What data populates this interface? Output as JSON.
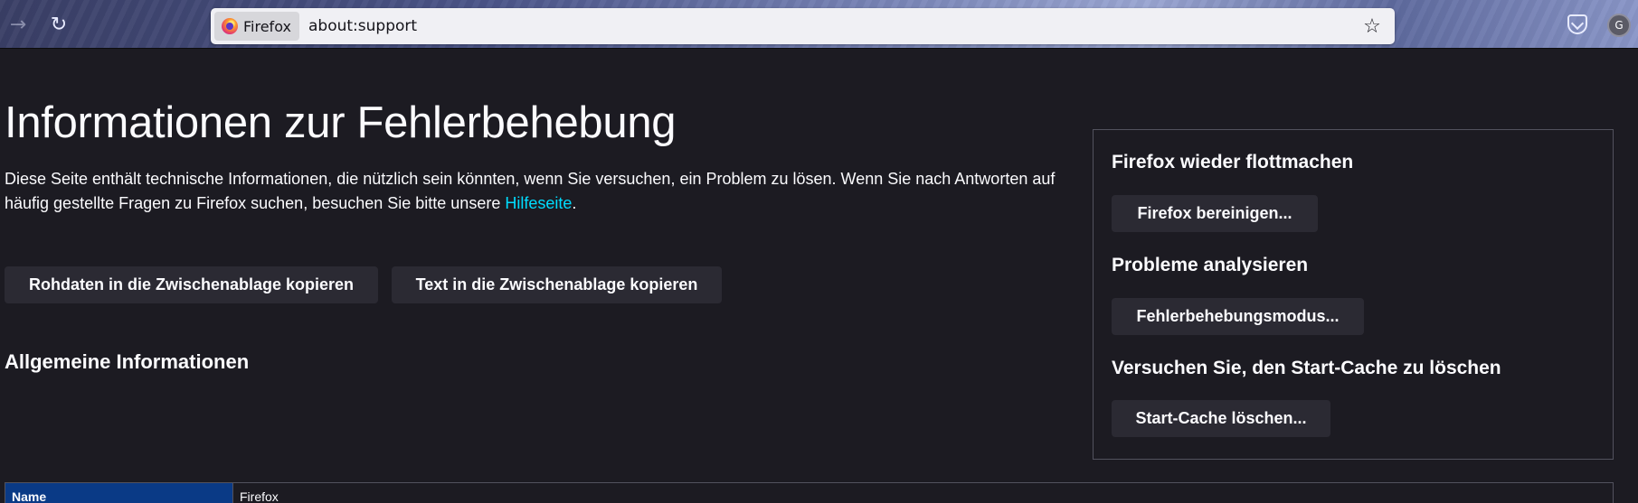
{
  "browser": {
    "identity_label": "Firefox",
    "url": "about:support",
    "icons": {
      "back": "back-arrow-icon",
      "reload": "reload-icon",
      "bookmark": "star-icon",
      "pocket": "pocket-icon",
      "account": "account-icon"
    },
    "account_initial": "G"
  },
  "page": {
    "title": "Informationen zur Fehlerbehebung",
    "intro_text": "Diese Seite enthält technische Informationen, die nützlich sein könnten, wenn Sie versuchen, ein Problem zu lösen. Wenn Sie nach Antworten auf häufig gestellte Fragen zu Firefox suchen, besuchen Sie bitte unsere ",
    "intro_link": "Hilfeseite",
    "intro_end": ".",
    "copy_raw_button": "Rohdaten in die Zwischenablage kopieren",
    "copy_text_button": "Text in die Zwischenablage kopieren",
    "general_heading": "Allgemeine Informationen"
  },
  "side_box": {
    "refresh_heading": "Firefox wieder flottmachen",
    "refresh_button": "Firefox bereinigen...",
    "troubleshoot_heading": "Probleme analysieren",
    "troubleshoot_button": "Fehlerbehebungsmodus...",
    "cache_heading": "Versuchen Sie, den Start-Cache zu löschen",
    "cache_button": "Start-Cache löschen..."
  },
  "table": {
    "rows": [
      {
        "name": "Name",
        "value": "Firefox"
      }
    ]
  },
  "colors": {
    "background": "#1c1b22",
    "button": "#2b2a33",
    "link": "#00ddff",
    "table_header": "#0a3a86"
  }
}
